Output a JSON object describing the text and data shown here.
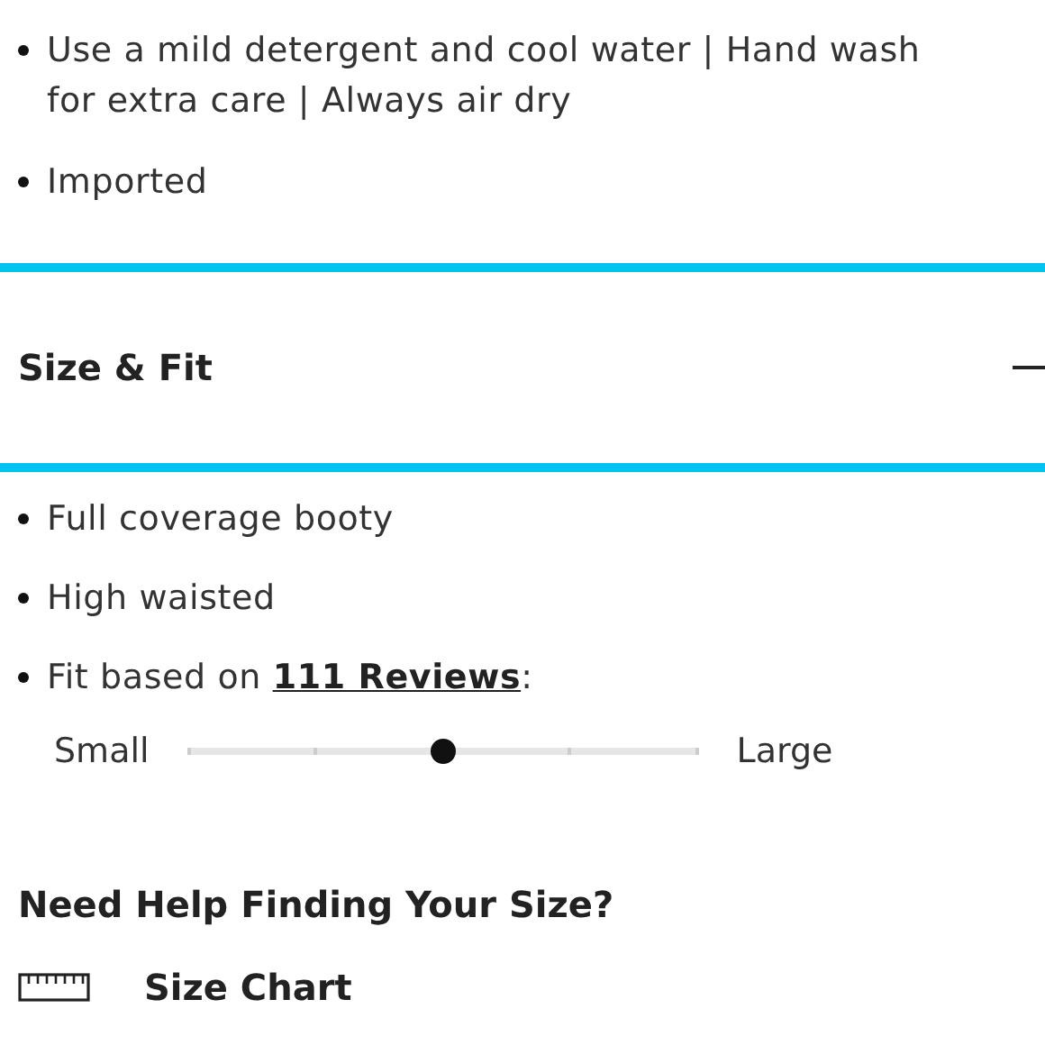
{
  "care_list": [
    {
      "text": "Use a mild detergent and cool water | Hand wash for extra care | Always air dry"
    },
    {
      "text": "Imported"
    }
  ],
  "section": {
    "title": "Size & Fit",
    "expanded": true
  },
  "fit_list": [
    {
      "text": "Full coverage booty"
    },
    {
      "text": "High waisted"
    },
    {
      "text": "Fit based on ",
      "link": "111 Reviews",
      "after": ":"
    }
  ],
  "fit_slider": {
    "min_label": "Small",
    "max_label": "Large",
    "level": 0.5
  },
  "help": {
    "heading": "Need Help Finding Your Size?",
    "size_chart": "Size Chart"
  }
}
